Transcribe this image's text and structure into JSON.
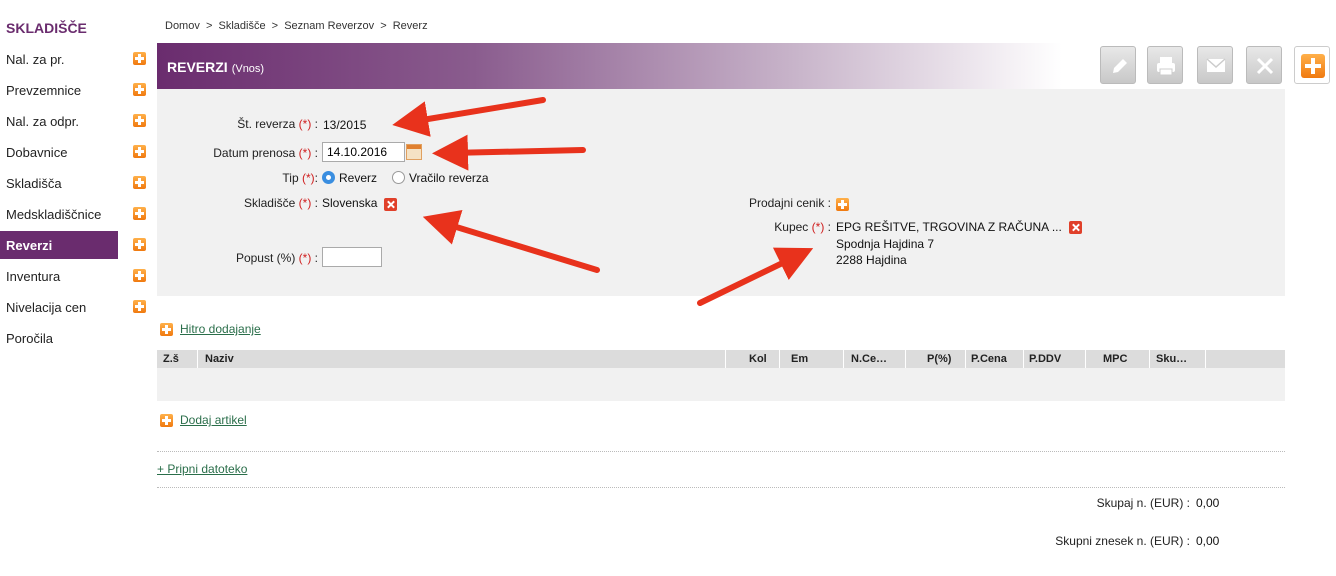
{
  "sidebar": {
    "title": "SKLADIŠČE",
    "items": [
      {
        "label": "Nal. za pr.",
        "has_add": true
      },
      {
        "label": "Prevzemnice",
        "has_add": true
      },
      {
        "label": "Nal. za odpr.",
        "has_add": true
      },
      {
        "label": "Dobavnice",
        "has_add": true
      },
      {
        "label": "Skladišča",
        "has_add": true
      },
      {
        "label": "Medskladiščnice",
        "has_add": true
      },
      {
        "label": "Reverzi",
        "has_add": true,
        "active": true
      },
      {
        "label": "Inventura",
        "has_add": true
      },
      {
        "label": "Nivelacija cen",
        "has_add": true
      },
      {
        "label": "Poročila",
        "has_add": false
      }
    ]
  },
  "breadcrumb": "Domov  >  Skladišče  >  Seznam Reverzov  >  Reverz",
  "header": {
    "title": "REVERZI",
    "subtitle": "(Vnos)"
  },
  "toolbar": {
    "buttons": [
      {
        "name": "edit",
        "icon": "pencil-icon"
      },
      {
        "name": "print",
        "icon": "printer-icon"
      },
      {
        "name": "email",
        "icon": "envelope-icon"
      },
      {
        "name": "delete",
        "icon": "close-icon"
      },
      {
        "name": "add",
        "icon": "plus-icon"
      }
    ]
  },
  "form": {
    "required_mark": "(*)",
    "st_reverza": {
      "label": "Št. reverza",
      "value": "13/2015"
    },
    "datum": {
      "label": "Datum prenosa",
      "value": "14.10.2016"
    },
    "tip": {
      "label": "Tip",
      "options": [
        "Reverz",
        "Vračilo reverza"
      ],
      "selected": "Reverz"
    },
    "skladisce": {
      "label": "Skladišče",
      "value": "Slovenska"
    },
    "popust": {
      "label": "Popust (%)",
      "value": ""
    },
    "prodajni_cenik": {
      "label": "Prodajni cenik :"
    },
    "kupec": {
      "label": "Kupec",
      "name": "EPG REŠITVE, TRGOVINA Z RAČUNA ...",
      "address1": "Spodnja Hajdina 7",
      "address2": "2288 Hajdina"
    }
  },
  "links": {
    "hitro": "Hitro dodajanje",
    "dodaj": "Dodaj artikel",
    "pripni": "+ Pripni datoteko"
  },
  "table": {
    "columns": [
      "Z.š",
      "Naziv",
      "Kol",
      "Em",
      "N.Ce…",
      "P(%)",
      "P.Cena",
      "P.DDV",
      "MPC",
      "Sku…"
    ]
  },
  "totals": {
    "skupaj_label": "Skupaj n. (EUR) :",
    "skupaj_value": "0,00",
    "znesek_label": "Skupni znesek n. (EUR) :",
    "znesek_value": "0,00"
  },
  "colors": {
    "brand": "#6a2c6e",
    "accent": "#f07a10",
    "arrow": "#e8321c"
  }
}
